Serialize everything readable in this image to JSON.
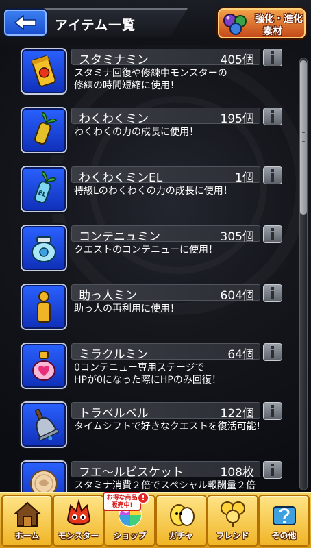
{
  "header": {
    "title": "アイテム一覧",
    "evolve_button": {
      "line1": "強化・進化",
      "line2": "素材"
    }
  },
  "items": [
    {
      "name": "スタミナミン",
      "count": "405個",
      "desc1": "スタミナ回復や修練中モンスターの",
      "desc2": "修練の時間短縮に使用！",
      "icon": "stamina-can-icon"
    },
    {
      "name": "わくわくミン",
      "count": "195個",
      "desc1": "わくわくの力の成長に使用！",
      "desc2": "",
      "icon": "sprout-bottle-icon"
    },
    {
      "name": "わくわくミンEL",
      "count": "1個",
      "desc1": "特級Lのわくわくの力の成長に使用！",
      "desc2": "",
      "icon": "el-bottle-icon"
    },
    {
      "name": "コンテニュミン",
      "count": "305個",
      "desc1": "クエストのコンテニューに使用！",
      "desc2": "",
      "icon": "continue-jar-icon"
    },
    {
      "name": "助っ人ミン",
      "count": "604個",
      "desc1": "助っ人の再利用に使用！",
      "desc2": "",
      "icon": "helper-bottle-icon"
    },
    {
      "name": "ミラクルミン",
      "count": "64個",
      "desc1": "0コンテニュー専用ステージで",
      "desc2": "HPが0になった際にHPのみ回復！",
      "icon": "heart-flask-icon"
    },
    {
      "name": "トラベルベル",
      "count": "122個",
      "desc1": "タイムシフトで好きなクエストを復活可能！",
      "desc2": "",
      "icon": "bell-icon"
    },
    {
      "name": "フエ〜ルビスケット",
      "count": "108枚",
      "desc1": "スタミナ消費２倍でスペシャル報酬量２倍",
      "desc2": "",
      "icon": "biscuit-icon"
    }
  ],
  "nav": {
    "items": [
      {
        "label": "ホーム",
        "icon": "home-icon"
      },
      {
        "label": "モンスター",
        "icon": "monster-icon"
      },
      {
        "label": "ショップ",
        "icon": "shop-orb-icon"
      },
      {
        "label": "ガチャ",
        "icon": "gacha-egg-icon"
      },
      {
        "label": "フレンド",
        "icon": "friend-balloons-icon"
      },
      {
        "label": "その他",
        "icon": "other-question-icon"
      }
    ],
    "promo_label": "お得な商品販売中!",
    "promo_badge": "!"
  },
  "colors": {
    "accent_blue": "#2a62ff",
    "nav_gold": "#f0b526",
    "evolve_orange": "#e0742f"
  }
}
